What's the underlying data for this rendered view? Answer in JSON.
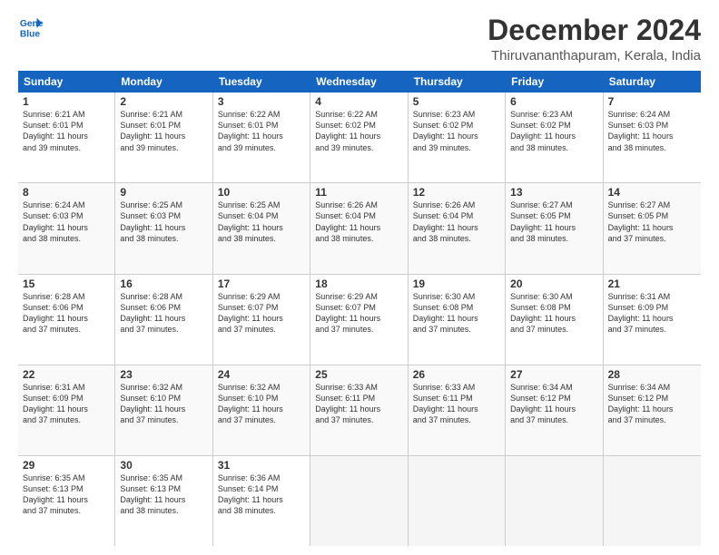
{
  "logo": {
    "line1": "General",
    "line2": "Blue"
  },
  "title": "December 2024",
  "subtitle": "Thiruvananthapuram, Kerala, India",
  "weekdays": [
    "Sunday",
    "Monday",
    "Tuesday",
    "Wednesday",
    "Thursday",
    "Friday",
    "Saturday"
  ],
  "weeks": [
    [
      {
        "day": "1",
        "lines": [
          "Sunrise: 6:21 AM",
          "Sunset: 6:01 PM",
          "Daylight: 11 hours",
          "and 39 minutes."
        ]
      },
      {
        "day": "2",
        "lines": [
          "Sunrise: 6:21 AM",
          "Sunset: 6:01 PM",
          "Daylight: 11 hours",
          "and 39 minutes."
        ]
      },
      {
        "day": "3",
        "lines": [
          "Sunrise: 6:22 AM",
          "Sunset: 6:01 PM",
          "Daylight: 11 hours",
          "and 39 minutes."
        ]
      },
      {
        "day": "4",
        "lines": [
          "Sunrise: 6:22 AM",
          "Sunset: 6:02 PM",
          "Daylight: 11 hours",
          "and 39 minutes."
        ]
      },
      {
        "day": "5",
        "lines": [
          "Sunrise: 6:23 AM",
          "Sunset: 6:02 PM",
          "Daylight: 11 hours",
          "and 39 minutes."
        ]
      },
      {
        "day": "6",
        "lines": [
          "Sunrise: 6:23 AM",
          "Sunset: 6:02 PM",
          "Daylight: 11 hours",
          "and 38 minutes."
        ]
      },
      {
        "day": "7",
        "lines": [
          "Sunrise: 6:24 AM",
          "Sunset: 6:03 PM",
          "Daylight: 11 hours",
          "and 38 minutes."
        ]
      }
    ],
    [
      {
        "day": "8",
        "lines": [
          "Sunrise: 6:24 AM",
          "Sunset: 6:03 PM",
          "Daylight: 11 hours",
          "and 38 minutes."
        ]
      },
      {
        "day": "9",
        "lines": [
          "Sunrise: 6:25 AM",
          "Sunset: 6:03 PM",
          "Daylight: 11 hours",
          "and 38 minutes."
        ]
      },
      {
        "day": "10",
        "lines": [
          "Sunrise: 6:25 AM",
          "Sunset: 6:04 PM",
          "Daylight: 11 hours",
          "and 38 minutes."
        ]
      },
      {
        "day": "11",
        "lines": [
          "Sunrise: 6:26 AM",
          "Sunset: 6:04 PM",
          "Daylight: 11 hours",
          "and 38 minutes."
        ]
      },
      {
        "day": "12",
        "lines": [
          "Sunrise: 6:26 AM",
          "Sunset: 6:04 PM",
          "Daylight: 11 hours",
          "and 38 minutes."
        ]
      },
      {
        "day": "13",
        "lines": [
          "Sunrise: 6:27 AM",
          "Sunset: 6:05 PM",
          "Daylight: 11 hours",
          "and 38 minutes."
        ]
      },
      {
        "day": "14",
        "lines": [
          "Sunrise: 6:27 AM",
          "Sunset: 6:05 PM",
          "Daylight: 11 hours",
          "and 37 minutes."
        ]
      }
    ],
    [
      {
        "day": "15",
        "lines": [
          "Sunrise: 6:28 AM",
          "Sunset: 6:06 PM",
          "Daylight: 11 hours",
          "and 37 minutes."
        ]
      },
      {
        "day": "16",
        "lines": [
          "Sunrise: 6:28 AM",
          "Sunset: 6:06 PM",
          "Daylight: 11 hours",
          "and 37 minutes."
        ]
      },
      {
        "day": "17",
        "lines": [
          "Sunrise: 6:29 AM",
          "Sunset: 6:07 PM",
          "Daylight: 11 hours",
          "and 37 minutes."
        ]
      },
      {
        "day": "18",
        "lines": [
          "Sunrise: 6:29 AM",
          "Sunset: 6:07 PM",
          "Daylight: 11 hours",
          "and 37 minutes."
        ]
      },
      {
        "day": "19",
        "lines": [
          "Sunrise: 6:30 AM",
          "Sunset: 6:08 PM",
          "Daylight: 11 hours",
          "and 37 minutes."
        ]
      },
      {
        "day": "20",
        "lines": [
          "Sunrise: 6:30 AM",
          "Sunset: 6:08 PM",
          "Daylight: 11 hours",
          "and 37 minutes."
        ]
      },
      {
        "day": "21",
        "lines": [
          "Sunrise: 6:31 AM",
          "Sunset: 6:09 PM",
          "Daylight: 11 hours",
          "and 37 minutes."
        ]
      }
    ],
    [
      {
        "day": "22",
        "lines": [
          "Sunrise: 6:31 AM",
          "Sunset: 6:09 PM",
          "Daylight: 11 hours",
          "and 37 minutes."
        ]
      },
      {
        "day": "23",
        "lines": [
          "Sunrise: 6:32 AM",
          "Sunset: 6:10 PM",
          "Daylight: 11 hours",
          "and 37 minutes."
        ]
      },
      {
        "day": "24",
        "lines": [
          "Sunrise: 6:32 AM",
          "Sunset: 6:10 PM",
          "Daylight: 11 hours",
          "and 37 minutes."
        ]
      },
      {
        "day": "25",
        "lines": [
          "Sunrise: 6:33 AM",
          "Sunset: 6:11 PM",
          "Daylight: 11 hours",
          "and 37 minutes."
        ]
      },
      {
        "day": "26",
        "lines": [
          "Sunrise: 6:33 AM",
          "Sunset: 6:11 PM",
          "Daylight: 11 hours",
          "and 37 minutes."
        ]
      },
      {
        "day": "27",
        "lines": [
          "Sunrise: 6:34 AM",
          "Sunset: 6:12 PM",
          "Daylight: 11 hours",
          "and 37 minutes."
        ]
      },
      {
        "day": "28",
        "lines": [
          "Sunrise: 6:34 AM",
          "Sunset: 6:12 PM",
          "Daylight: 11 hours",
          "and 37 minutes."
        ]
      }
    ],
    [
      {
        "day": "29",
        "lines": [
          "Sunrise: 6:35 AM",
          "Sunset: 6:13 PM",
          "Daylight: 11 hours",
          "and 37 minutes."
        ]
      },
      {
        "day": "30",
        "lines": [
          "Sunrise: 6:35 AM",
          "Sunset: 6:13 PM",
          "Daylight: 11 hours",
          "and 38 minutes."
        ]
      },
      {
        "day": "31",
        "lines": [
          "Sunrise: 6:36 AM",
          "Sunset: 6:14 PM",
          "Daylight: 11 hours",
          "and 38 minutes."
        ]
      },
      {
        "day": "",
        "lines": []
      },
      {
        "day": "",
        "lines": []
      },
      {
        "day": "",
        "lines": []
      },
      {
        "day": "",
        "lines": []
      }
    ]
  ]
}
